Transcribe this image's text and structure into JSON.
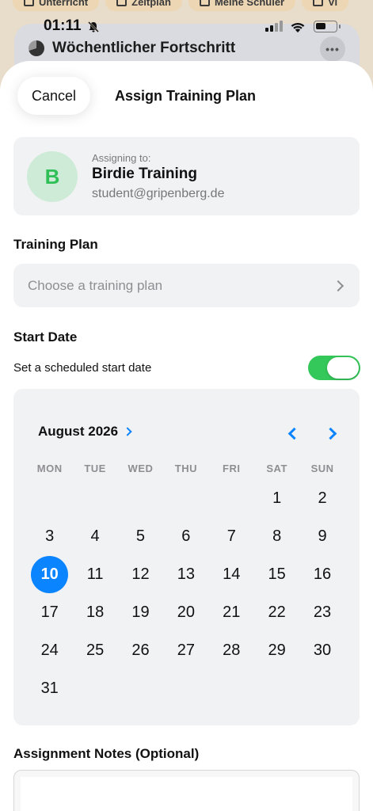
{
  "background": {
    "tabs": [
      {
        "label": "Unterricht"
      },
      {
        "label": "Zeitplan"
      },
      {
        "label": "Meine Schüler"
      },
      {
        "label": "Vi"
      }
    ],
    "card_title": "Wöchentlicher Fortschritt"
  },
  "status_bar": {
    "time": "01:11"
  },
  "sheet": {
    "cancel_label": "Cancel",
    "title": "Assign Training Plan",
    "assignee": {
      "label": "Assigning to:",
      "initial": "B",
      "name": "Birdie Training",
      "email": "student@gripenberg.de",
      "avatar_color": "#cdebd6",
      "initial_color": "#2fbf57"
    },
    "training_plan": {
      "heading": "Training Plan",
      "placeholder": "Choose a training plan"
    },
    "start_date": {
      "heading": "Start Date",
      "toggle_label": "Set a scheduled start date",
      "toggle_on": true,
      "toggle_color": "#34c759"
    },
    "calendar": {
      "month_label": "August 2026",
      "accent": "#0a84ff",
      "weekdays": [
        "MON",
        "TUE",
        "WED",
        "THU",
        "FRI",
        "SAT",
        "SUN"
      ],
      "leading_blank_days": 5,
      "days": [
        "1",
        "2",
        "3",
        "4",
        "5",
        "6",
        "7",
        "8",
        "9",
        "10",
        "11",
        "12",
        "13",
        "14",
        "15",
        "16",
        "17",
        "18",
        "19",
        "20",
        "21",
        "22",
        "23",
        "24",
        "25",
        "26",
        "27",
        "28",
        "29",
        "30",
        "31"
      ],
      "selected_day": "10"
    },
    "notes": {
      "heading": "Assignment Notes (Optional)"
    }
  }
}
